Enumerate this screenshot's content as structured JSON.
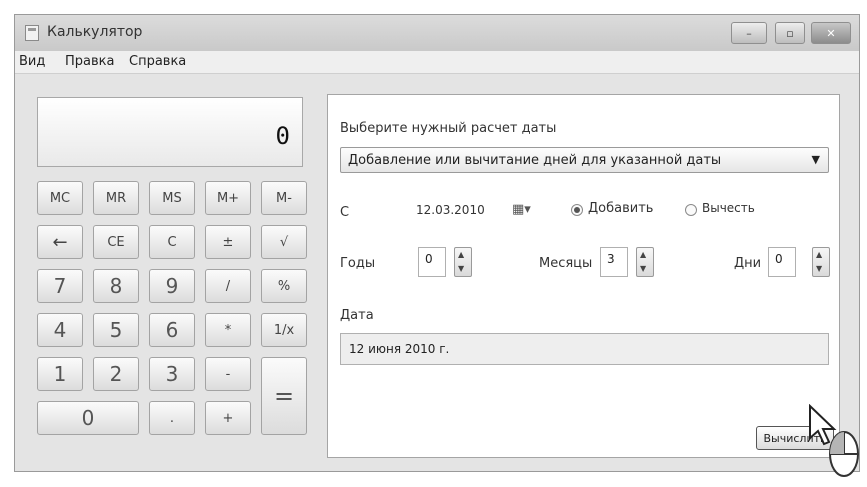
{
  "window": {
    "title": "Калькулятор",
    "controls": {
      "minimize": "–",
      "maximize": "▫",
      "close": "✕"
    }
  },
  "menu": [
    "Вид",
    "Правка",
    "Справка"
  ],
  "display": {
    "value": "0"
  },
  "keys": [
    [
      "MC",
      "MR",
      "MS",
      "M+",
      "M-"
    ],
    [
      "←",
      "CE",
      "C",
      "±",
      "√"
    ],
    [
      "7",
      "8",
      "9",
      "/",
      "%"
    ],
    [
      "4",
      "5",
      "6",
      "*",
      "1/x"
    ],
    [
      "1",
      "2",
      "3",
      "-",
      "="
    ],
    [
      "0",
      ".",
      "+"
    ]
  ],
  "date_calc": {
    "prompt": "Выберите нужный расчет даты",
    "mode": "Добавление или вычитание дней для указанной даты",
    "from_label": "С",
    "from_date": "12.03.2010",
    "add_label": "Добавить",
    "subtract_label": "Вычесть",
    "operation": "add",
    "years_label": "Годы",
    "years": "0",
    "months_label": "Месяцы",
    "months": "3",
    "days_label": "Дни",
    "days": "0",
    "result_label": "Дата",
    "result": "12 июня 2010 г.",
    "calculate_button": "Вычислить"
  },
  "icons": {
    "combo_arrow": "chevron-down-icon",
    "calendar": "calendar-icon",
    "spin": "spinner-arrows-icon",
    "cursor": "mouse-pointer-icon"
  }
}
